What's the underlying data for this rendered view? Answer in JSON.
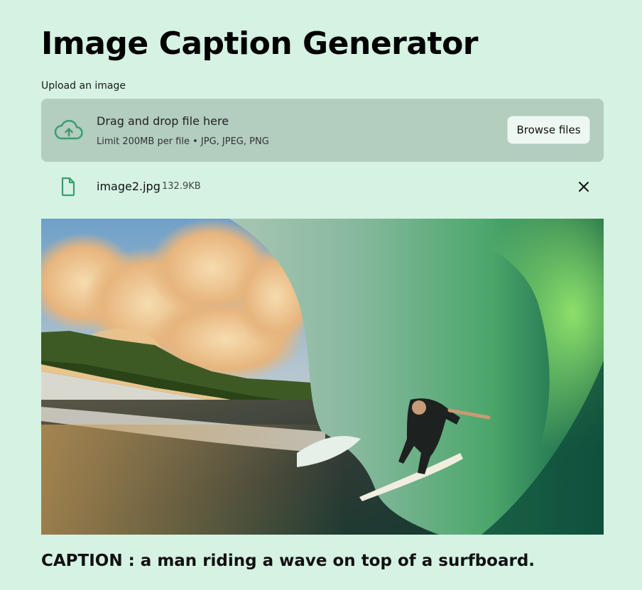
{
  "app": {
    "title": "Image Caption Generator"
  },
  "uploader": {
    "label": "Upload an image",
    "drop_title": "Drag and drop file here",
    "drop_subtitle": "Limit 200MB per file • JPG, JPEG, PNG",
    "browse_label": "Browse files",
    "icon": "cloud-upload-icon"
  },
  "uploaded_file": {
    "name": "image2.jpg",
    "size": "132.9KB",
    "icon": "file-icon",
    "remove_icon": "close-icon"
  },
  "caption": {
    "text": "CAPTION : a man riding a wave on top of a surfboard."
  },
  "colors": {
    "page_background": "#d5f2e3",
    "dropzone_background": "#b3cdbf",
    "icon_accent": "#3a9e6f"
  }
}
